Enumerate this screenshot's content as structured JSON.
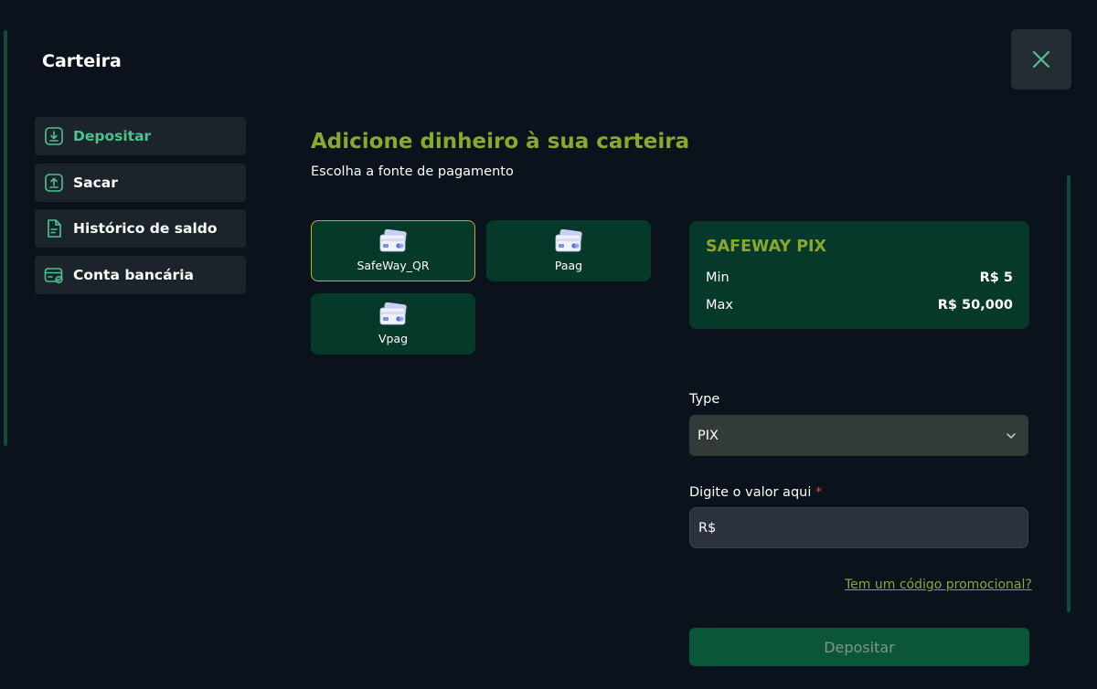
{
  "modal": {
    "title": "Carteira"
  },
  "sidebar": {
    "items": [
      {
        "label": "Depositar",
        "icon": "download-icon",
        "active": true
      },
      {
        "label": "Sacar",
        "icon": "upload-icon"
      },
      {
        "label": "Histórico de saldo",
        "icon": "document-icon"
      },
      {
        "label": "Conta bancária",
        "icon": "bank-card-icon"
      }
    ]
  },
  "main": {
    "title": "Adicione dinheiro à sua carteira",
    "subtitle": "Escolha a fonte de pagamento"
  },
  "payment_methods": [
    {
      "label": "SafeWay_QR",
      "selected": true
    },
    {
      "label": "Paag"
    },
    {
      "label": "Vpag"
    }
  ],
  "info": {
    "title": "SAFEWAY PIX",
    "min_label": "Min",
    "min_value": "R$ 5",
    "max_label": "Max",
    "max_value": "R$ 50,000"
  },
  "form": {
    "type_label": "Type",
    "type_value": "PIX",
    "amount_label": "Digite o valor aqui",
    "amount_required": "*",
    "amount_placeholder": "R$",
    "promo_link": "Tem um código promocional?",
    "submit_label": "Depositar"
  },
  "colors": {
    "accent_green": "#4fc290",
    "title_olive": "#8aa82e",
    "card_bg": "#06392a",
    "selected_border": "#b6b325",
    "page_bg": "#0a121b"
  }
}
